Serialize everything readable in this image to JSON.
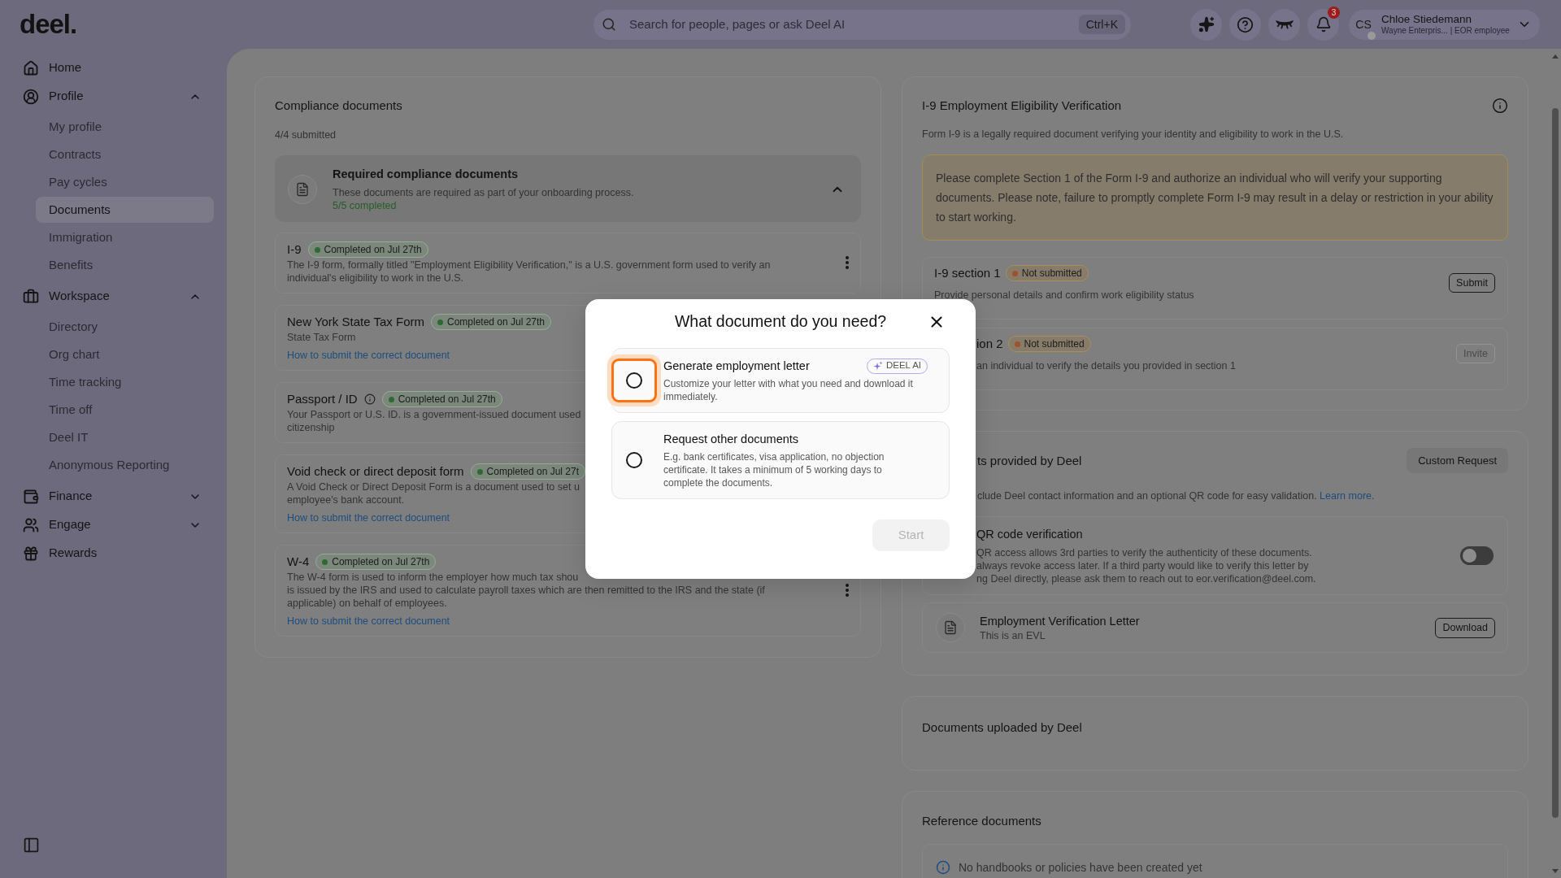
{
  "topbar": {
    "logo": "deel.",
    "search": {
      "placeholder": "Search for people, pages or ask Deel AI",
      "shortcut": "Ctrl+K"
    },
    "notifications": "3",
    "user": {
      "initials": "CS",
      "name": "Chloe Stiedemann",
      "subtitle": "Wayne Enterpris... | EOR employee"
    }
  },
  "sidebar": {
    "items": [
      {
        "label": "Home",
        "selected": false
      },
      {
        "label": "Profile",
        "selected": false,
        "expanded": true,
        "children": [
          {
            "label": "My profile",
            "selected": false
          },
          {
            "label": "Contracts",
            "selected": false
          },
          {
            "label": "Pay cycles",
            "selected": false
          },
          {
            "label": "Documents",
            "selected": true
          },
          {
            "label": "Immigration",
            "selected": false
          },
          {
            "label": "Benefits",
            "selected": false
          }
        ]
      },
      {
        "label": "Workspace",
        "selected": false,
        "expanded": true,
        "children": [
          {
            "label": "Directory",
            "selected": false
          },
          {
            "label": "Org chart",
            "selected": false
          },
          {
            "label": "Time tracking",
            "selected": false
          },
          {
            "label": "Time off",
            "selected": false
          },
          {
            "label": "Deel IT",
            "selected": false
          },
          {
            "label": "Anonymous Reporting",
            "selected": false
          }
        ]
      },
      {
        "label": "Finance",
        "selected": false,
        "expanded": false
      },
      {
        "label": "Engage",
        "selected": false,
        "expanded": false
      },
      {
        "label": "Rewards",
        "selected": false
      }
    ]
  },
  "compliance": {
    "title": "Compliance documents",
    "summary": "4/4 submitted",
    "group": {
      "title": "Required compliance documents",
      "description": "These documents are required as part of your onboarding process.",
      "progress": "5/5 completed",
      "completed": true,
      "expanded": true
    },
    "documents": [
      {
        "title": "I-9",
        "status": "Completed on Jul 27th",
        "info": false,
        "description": "The I-9 form, formally titled \"Employment Eligibility Verification,\" is a U.S. government form used to verify an individual's eligibility to work in the U.S.",
        "menu": true
      },
      {
        "title": "New York State Tax Form",
        "status": "Completed on Jul 27th",
        "info": false,
        "description": "State Tax Form",
        "link": "How to submit the correct document",
        "menu": false
      },
      {
        "title": "Passport / ID",
        "status": "Completed on Jul 27th",
        "info": true,
        "description_lines": [
          "Your Passport or U.S. ID. is a government-issued document used",
          "citizenship"
        ],
        "menu": false
      },
      {
        "title": "Void check or direct deposit form",
        "status": "Completed on Jul 27t",
        "info": false,
        "description_lines": [
          "A Void Check or Direct Deposit Form is a document used to set u",
          "employee's bank account."
        ],
        "link": "How to submit the correct document",
        "menu": false
      },
      {
        "title": "W-4",
        "status": "Completed on Jul 27th",
        "info": false,
        "description_lines": [
          "The W-4 form is used to inform the employer how much tax shou",
          "is issued by the IRS and used to calculate payroll taxes which are then remitted to the IRS and the state (if",
          "applicable) on behalf of employees."
        ],
        "link": "How to submit the correct document",
        "menu": true
      }
    ]
  },
  "i9": {
    "title": "I-9 Employment Eligibility Verification",
    "description": "Form I-9 is a legally required document verifying your identity and eligibility to work in the U.S.",
    "notice": "Please complete Section 1 of the Form I-9 and authorize an individual who will verify your supporting documents. Please note, failure to promptly complete Form I-9 may result in a delay or restriction in your ability to start working.",
    "sections": [
      {
        "title": "I-9 section 1",
        "status": "Not submitted",
        "description": "Provide personal details and confirm work eligibility status",
        "action": "Submit",
        "action_disabled": false
      },
      {
        "title": "ion 2",
        "status": "Not submitted",
        "description": "an individual to verify the details you provided in section 1",
        "action": "Invite",
        "action_disabled": true
      }
    ]
  },
  "deel_documents": {
    "title": "ts provided by Deel",
    "action": "Custom Request",
    "description": "clude Deel contact information and an optional QR code for easy validation.",
    "link": "Learn more.",
    "qr": {
      "title": "QR code verification",
      "description_lines": [
        "QR access allows 3rd parties to verify the authenticity of these documents.",
        "always revoke access later. If a third party would like to verify this letter by",
        "ng Deel directly, please ask them to reach out to eor.verification@deel.com."
      ],
      "on": false
    },
    "letter": {
      "title": "Employment Verification Letter",
      "subtitle": "This is an EVL",
      "action": "Download"
    }
  },
  "uploaded": {
    "title": "Documents uploaded by Deel"
  },
  "reference": {
    "title": "Reference documents",
    "message": "No handbooks or policies have been created yet"
  },
  "modal": {
    "title": "What document do you need?",
    "options": [
      {
        "title": "Generate employment letter",
        "badge": "DEEL AI",
        "description": "Customize your letter with what you need and download it immediately.",
        "selected": false,
        "focused": true
      },
      {
        "title": "Request other documents",
        "description": "E.g. bank certificates, visa application, no objection certificate. It takes a minimum of 5 working days to complete the documents.",
        "selected": false,
        "focused": false
      }
    ],
    "action": "Start",
    "action_disabled": true
  }
}
